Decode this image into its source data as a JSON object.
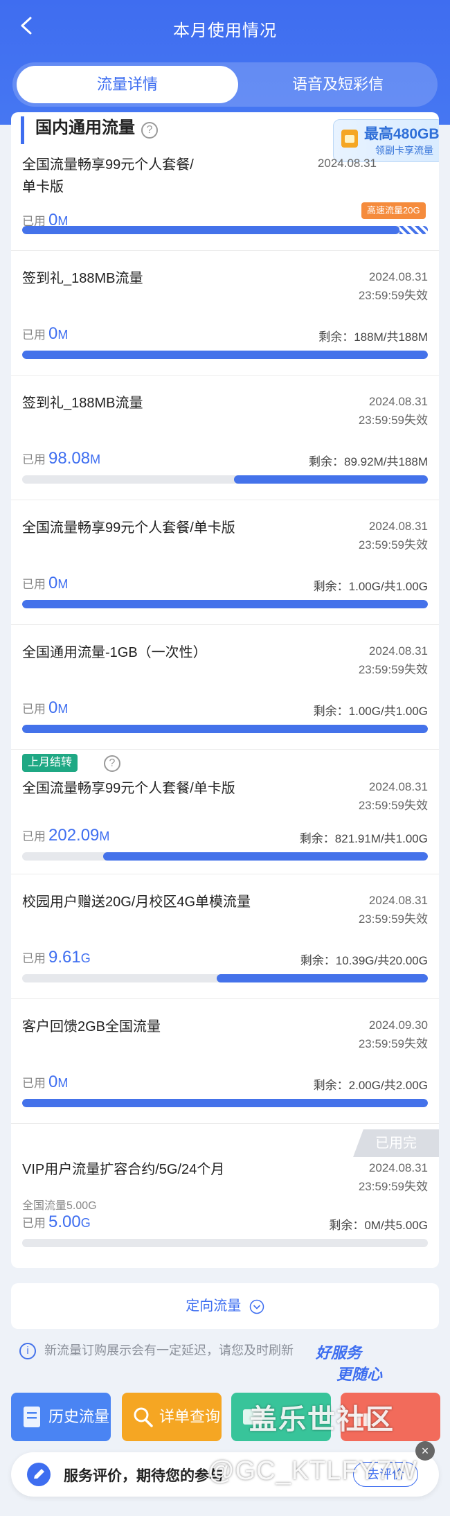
{
  "header": {
    "title": "本月使用情况"
  },
  "tabs": [
    {
      "label": "流量详情",
      "active": true
    },
    {
      "label": "语音及短彩信",
      "active": false
    }
  ],
  "section": {
    "title": "国内通用流量"
  },
  "promo": {
    "main": "最高480GB",
    "sub": "领副卡享流量"
  },
  "items": [
    {
      "name": "全国流量畅享99元个人套餐/",
      "name2": "单卡版",
      "date": "2024.08.31",
      "used_label": "已用",
      "used_value": "0",
      "used_unit": "M",
      "speed_tag": "高速流量20G",
      "fill": 0.93
    },
    {
      "name": "签到礼_188MB流量",
      "date": "2024.08.31",
      "expiry": "23:59:59失效",
      "used_label": "已用",
      "used_value": "0",
      "used_unit": "M",
      "remain": "剩余：188M/共188M",
      "fill": 1.0
    },
    {
      "name": "签到礼_188MB流量",
      "date": "2024.08.31",
      "expiry": "23:59:59失效",
      "used_label": "已用",
      "used_value": "98.08",
      "used_unit": "M",
      "remain": "剩余：89.92M/共188M",
      "fill": 0.478
    },
    {
      "name": "全国流量畅享99元个人套餐/单卡版",
      "date": "2024.08.31",
      "expiry": "23:59:59失效",
      "used_label": "已用",
      "used_value": "0",
      "used_unit": "M",
      "remain": "剩余：1.00G/共1.00G",
      "fill": 1.0
    },
    {
      "name": "全国通用流量-1GB（一次性）",
      "date": "2024.08.31",
      "expiry": "23:59:59失效",
      "used_label": "已用",
      "used_value": "0",
      "used_unit": "M",
      "remain": "剩余：1.00G/共1.00G",
      "fill": 1.0
    },
    {
      "tag": "上月结转",
      "name": "全国流量畅享99元个人套餐/单卡版",
      "date": "2024.08.31",
      "expiry": "23:59:59失效",
      "used_label": "已用",
      "used_value": "202.09",
      "used_unit": "M",
      "remain": "剩余：821.91M/共1.00G",
      "fill": 0.8
    },
    {
      "name": "校园用户赠送20G/月校区4G单模流量",
      "date": "2024.08.31",
      "expiry": "23:59:59失效",
      "used_label": "已用",
      "used_value": "9.61",
      "used_unit": "G",
      "remain": "剩余：10.39G/共20.00G",
      "fill": 0.52
    },
    {
      "name": "客户回馈2GB全国流量",
      "date": "2024.09.30",
      "expiry": "23:59:59失效",
      "used_label": "已用",
      "used_value": "0",
      "used_unit": "M",
      "remain": "剩余：2.00G/共2.00G",
      "fill": 1.0
    },
    {
      "status_tag": "已用完",
      "name": "VIP用户流量扩容合约/5G/24个月",
      "date": "2024.08.31",
      "expiry": "23:59:59失效",
      "sub_label": "全国流量5.00G",
      "used_label": "已用",
      "used_value": "5.00",
      "used_unit": "G",
      "remain": "剩余：0M/共5.00G",
      "fill": 0.0
    }
  ],
  "directional": {
    "label": "定向流量"
  },
  "notice": {
    "text": "新流量订购展示会有一定延迟，请您及时刷新"
  },
  "slogan": {
    "line1": "好服务",
    "line2": "更随心"
  },
  "quick_buttons": [
    {
      "label": "历史流量",
      "color": "#4a84f3"
    },
    {
      "label": "详单查询",
      "color": "#f5a623"
    },
    {
      "label": "",
      "color": "#38c49a"
    },
    {
      "label": "",
      "color": "#f26b5b"
    }
  ],
  "watermark": {
    "brand": "盖乐世社区",
    "handle": "@GC_KTLFY7W"
  },
  "survey": {
    "text": "服务评价，期待您的参与",
    "button": "去评价"
  },
  "colors": {
    "primary": "#3e6ef0",
    "bar": "#4472ea",
    "carry_tag": "#1fa884",
    "speed_tag": "#f58b3c"
  }
}
